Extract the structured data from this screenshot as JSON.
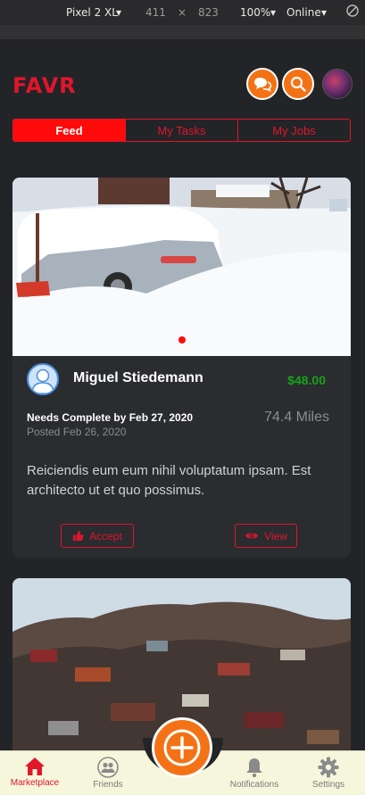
{
  "devtools": {
    "device": "Pixel 2 XL",
    "width": "411",
    "times": "×",
    "height": "823",
    "zoom": "100%",
    "network": "Online"
  },
  "header": {
    "logo": "FAVR"
  },
  "tabs": [
    {
      "label": "Feed",
      "active": true
    },
    {
      "label": "My Tasks",
      "active": false
    },
    {
      "label": "My Jobs",
      "active": false
    }
  ],
  "cards": [
    {
      "user_name": "Miguel Stiedemann",
      "price": "$48.00",
      "needs": "Needs Complete by Feb 27, 2020",
      "posted": "Posted Feb 26, 2020",
      "distance": "74.4 Miles",
      "description": "Reiciendis eum eum nihil voluptatum ipsam. Est architecto ut et quo possimus.",
      "accept_label": "Accept",
      "view_label": "View"
    }
  ],
  "bottom_nav": {
    "marketplace": "Marketplace",
    "friends": "Friends",
    "notifications": "Notifications",
    "settings": "Settings"
  },
  "colors": {
    "accent_red": "#e0162b",
    "accent_orange": "#f47216",
    "price_green": "#18a318",
    "background": "#222428"
  }
}
